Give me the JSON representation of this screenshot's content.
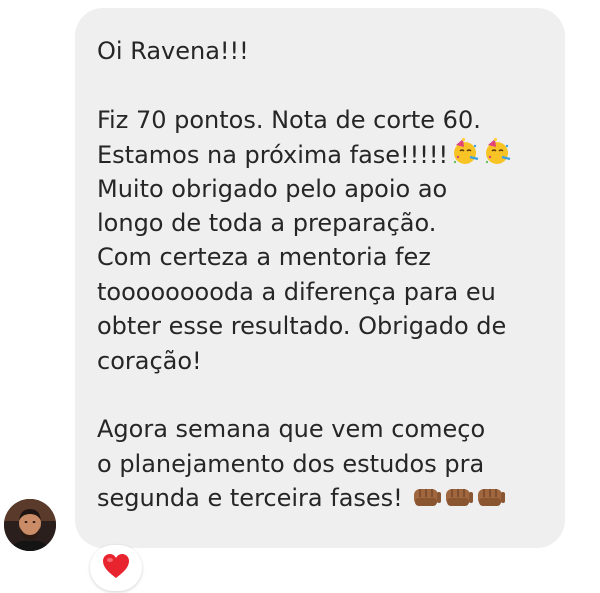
{
  "message": {
    "lines": [
      "Oi Ravena!!!",
      "",
      "Fiz 70 pontos. Nota de corte 60.",
      "Estamos na próxima fase!!!!!",
      "Muito obrigado pelo apoio ao",
      "longo de toda a preparação.",
      "Com certeza a mentoria fez",
      "tooooooooda a diferença para eu",
      "obter esse resultado. Obrigado de",
      "coração!",
      "",
      "Agora semana que vem começo",
      "o planejamento dos estudos pra",
      "segunda e terceira fases!"
    ],
    "inline_emojis": {
      "line_3": [
        "partying-face-icon",
        "partying-face-icon"
      ],
      "line_13": [
        "fist-bump-icon",
        "fist-bump-icon",
        "fist-bump-icon"
      ]
    }
  },
  "reaction": {
    "icon": "red-heart-icon",
    "color": "#e8242f"
  },
  "colors": {
    "bubble_background": "#efefef",
    "text": "#262626"
  }
}
